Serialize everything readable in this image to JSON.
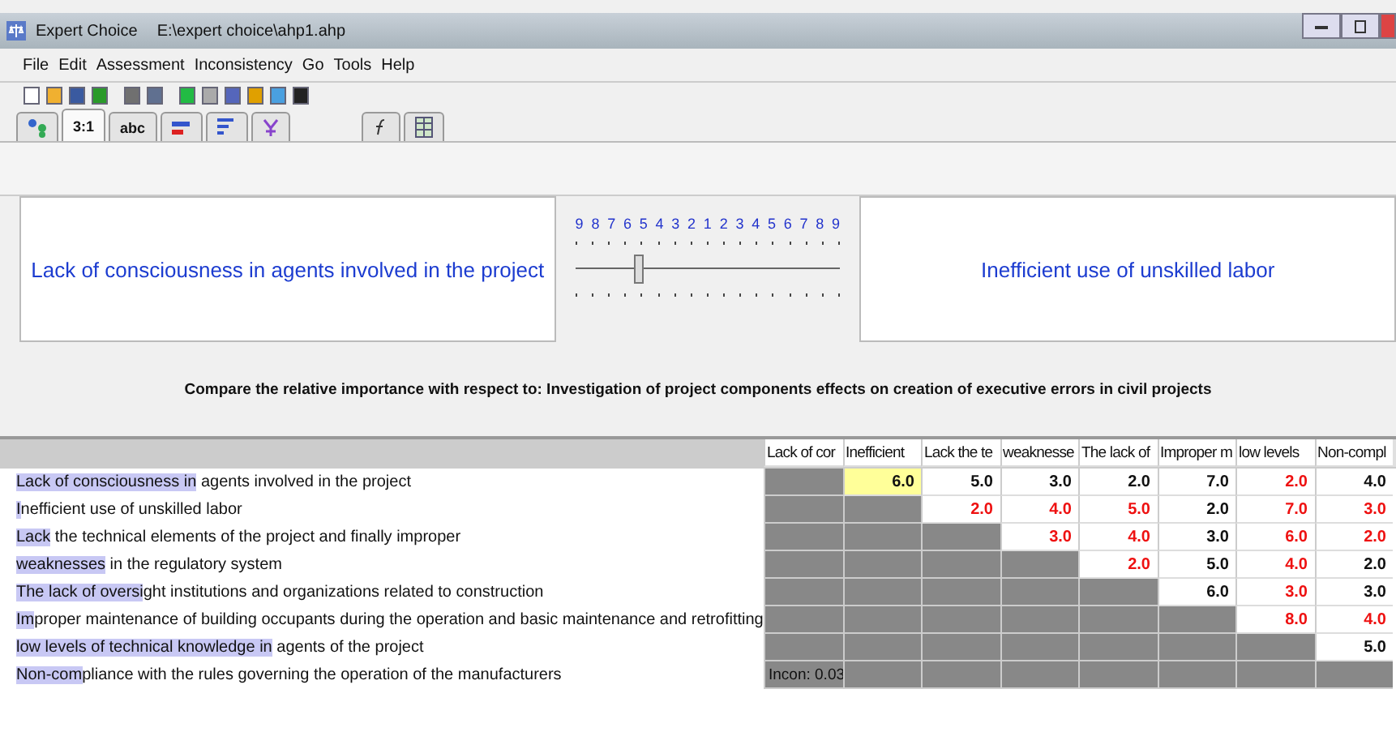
{
  "window": {
    "title": "Expert Choice",
    "file": "E:\\expert choice\\ahp1.ahp"
  },
  "menu": [
    {
      "label": "File"
    },
    {
      "label": "Edit"
    },
    {
      "label": "Assessment"
    },
    {
      "label": "Inconsistency"
    },
    {
      "label": "Go"
    },
    {
      "label": "Tools"
    },
    {
      "label": "Help"
    }
  ],
  "tabs": [
    {
      "kind": "tree",
      "selected": false
    },
    {
      "kind": "text",
      "label": "3:1",
      "selected": true
    },
    {
      "kind": "text",
      "label": "abc",
      "selected": false
    },
    {
      "kind": "bar",
      "selected": false
    },
    {
      "kind": "bars",
      "selected": false
    },
    {
      "kind": "branch",
      "selected": false
    },
    {
      "kind": "formula",
      "selected": false
    },
    {
      "kind": "grid",
      "selected": false
    }
  ],
  "comparison": {
    "left": "Lack of consciousness in agents involved in the project",
    "right": "Inefficient use of unskilled labor",
    "scale": [
      "9",
      "8",
      "7",
      "6",
      "5",
      "4",
      "3",
      "2",
      "1",
      "2",
      "3",
      "4",
      "5",
      "6",
      "7",
      "8",
      "9"
    ],
    "level": 0.22
  },
  "prompt": "Compare the relative importance with respect to: Investigation of project components effects on creation of executive errors in civil projects",
  "matrix": {
    "columns": [
      "Lack of cor",
      "Inefficient",
      "Lack the te",
      "weaknesse",
      "The lack of",
      "Improper m",
      "low levels",
      "Non-compl"
    ],
    "rows": [
      {
        "highlight": "Lack of consciousness in",
        "rest": " agents involved in the project",
        "cells": [
          {
            "kind": "gray"
          },
          {
            "kind": "value",
            "value": "6.0",
            "inverted": false,
            "selected": true
          },
          {
            "kind": "value",
            "value": "5.0",
            "inverted": false,
            "selected": false
          },
          {
            "kind": "value",
            "value": "3.0",
            "inverted": false,
            "selected": false
          },
          {
            "kind": "value",
            "value": "2.0",
            "inverted": false,
            "selected": false
          },
          {
            "kind": "value",
            "value": "7.0",
            "inverted": false,
            "selected": false
          },
          {
            "kind": "value",
            "value": "2.0",
            "inverted": true,
            "selected": false
          },
          {
            "kind": "value",
            "value": "4.0",
            "inverted": false,
            "selected": false
          }
        ]
      },
      {
        "highlight": "I",
        "rest": "nefficient use of unskilled labor",
        "cells": [
          {
            "kind": "gray"
          },
          {
            "kind": "gray"
          },
          {
            "kind": "value",
            "value": "2.0",
            "inverted": true,
            "selected": false
          },
          {
            "kind": "value",
            "value": "4.0",
            "inverted": true,
            "selected": false
          },
          {
            "kind": "value",
            "value": "5.0",
            "inverted": true,
            "selected": false
          },
          {
            "kind": "value",
            "value": "2.0",
            "inverted": false,
            "selected": false
          },
          {
            "kind": "value",
            "value": "7.0",
            "inverted": true,
            "selected": false
          },
          {
            "kind": "value",
            "value": "3.0",
            "inverted": true,
            "selected": false
          }
        ]
      },
      {
        "highlight": "Lack",
        "rest": " the technical elements of the project and finally improper",
        "cells": [
          {
            "kind": "gray"
          },
          {
            "kind": "gray"
          },
          {
            "kind": "gray"
          },
          {
            "kind": "value",
            "value": "3.0",
            "inverted": true,
            "selected": false
          },
          {
            "kind": "value",
            "value": "4.0",
            "inverted": true,
            "selected": false
          },
          {
            "kind": "value",
            "value": "3.0",
            "inverted": false,
            "selected": false
          },
          {
            "kind": "value",
            "value": "6.0",
            "inverted": true,
            "selected": false
          },
          {
            "kind": "value",
            "value": "2.0",
            "inverted": true,
            "selected": false
          }
        ]
      },
      {
        "highlight": "weaknesses",
        "rest": " in the regulatory system",
        "cells": [
          {
            "kind": "gray"
          },
          {
            "kind": "gray"
          },
          {
            "kind": "gray"
          },
          {
            "kind": "gray"
          },
          {
            "kind": "value",
            "value": "2.0",
            "inverted": true,
            "selected": false
          },
          {
            "kind": "value",
            "value": "5.0",
            "inverted": false,
            "selected": false
          },
          {
            "kind": "value",
            "value": "4.0",
            "inverted": true,
            "selected": false
          },
          {
            "kind": "value",
            "value": "2.0",
            "inverted": false,
            "selected": false
          }
        ]
      },
      {
        "highlight": "The lack of oversi",
        "rest": "ght institutions and organizations related to construction",
        "cells": [
          {
            "kind": "gray"
          },
          {
            "kind": "gray"
          },
          {
            "kind": "gray"
          },
          {
            "kind": "gray"
          },
          {
            "kind": "gray"
          },
          {
            "kind": "value",
            "value": "6.0",
            "inverted": false,
            "selected": false
          },
          {
            "kind": "value",
            "value": "3.0",
            "inverted": true,
            "selected": false
          },
          {
            "kind": "value",
            "value": "3.0",
            "inverted": false,
            "selected": false
          }
        ]
      },
      {
        "highlight": "Im",
        "rest": "proper maintenance of building occupants during the operation and basic maintenance and retrofitting",
        "cells": [
          {
            "kind": "gray"
          },
          {
            "kind": "gray"
          },
          {
            "kind": "gray"
          },
          {
            "kind": "gray"
          },
          {
            "kind": "gray"
          },
          {
            "kind": "gray"
          },
          {
            "kind": "value",
            "value": "8.0",
            "inverted": true,
            "selected": false
          },
          {
            "kind": "value",
            "value": "4.0",
            "inverted": true,
            "selected": false
          }
        ]
      },
      {
        "highlight": "low levels of technical knowledge in",
        "rest": " agents of the project",
        "cells": [
          {
            "kind": "gray"
          },
          {
            "kind": "gray"
          },
          {
            "kind": "gray"
          },
          {
            "kind": "gray"
          },
          {
            "kind": "gray"
          },
          {
            "kind": "gray"
          },
          {
            "kind": "gray"
          },
          {
            "kind": "value",
            "value": "5.0",
            "inverted": false,
            "selected": false
          }
        ]
      },
      {
        "highlight": "Non-com",
        "rest": "pliance with the rules governing the operation of the manufacturers",
        "cells": [
          {
            "kind": "note",
            "value": "Incon: 0.03"
          },
          {
            "kind": "gray"
          },
          {
            "kind": "gray"
          },
          {
            "kind": "gray"
          },
          {
            "kind": "gray"
          },
          {
            "kind": "gray"
          },
          {
            "kind": "gray"
          },
          {
            "kind": "gray"
          }
        ]
      }
    ]
  }
}
